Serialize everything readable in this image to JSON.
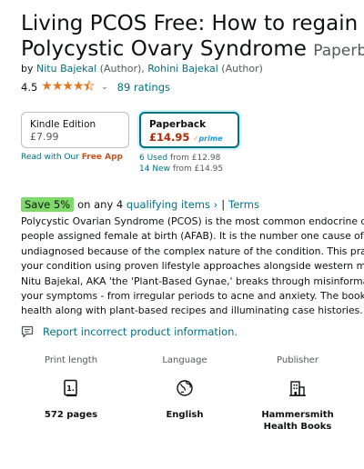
{
  "product": {
    "title": "Living PCOS Free: How to regain your health from",
    "title_line1": "Living PCOS Free: How to regain your",
    "title_line2": "Polycystic Ovary Syndrome",
    "format_label": "Paperback"
  },
  "byline": {
    "by": "by",
    "author1": "Nitu Bajekal",
    "author1_role": "(Author),",
    "author2": "Rohini Bajekal",
    "author2_role": "(Author)"
  },
  "rating": {
    "value": "4.5",
    "stars": "★★★★★",
    "stars_fraction": 0.9,
    "count_text": "89 ratings"
  },
  "formats": [
    {
      "name": "Kindle Edition",
      "price": "£7.99",
      "selected": false
    },
    {
      "name": "Paperback",
      "price": "£14.95",
      "prime": "prime",
      "selected": true
    }
  ],
  "read_app": {
    "prefix": "Read with Our",
    "highlight": "Free App"
  },
  "offers": {
    "used": "6 Used",
    "used_from": "from £12.98",
    "new": "14 New",
    "new_from": "from £14.95"
  },
  "promo": {
    "badge": "Save 5%",
    "text": "on any 4",
    "link": "qualifying items",
    "sep": "|",
    "terms": "Terms"
  },
  "description_lines": [
    "Polycystic Ovarian Syndrome (PCOS) is the most common endocrine disorder in",
    "people assigned female at birth (AFAB). It is the number one cause of infertility",
    "undiagnosed because of the complex nature of the condition. This practical guide",
    "your condition using proven lifestyle approaches alongside western medicine.",
    "Nitu Bajekal, AKA 'the 'Plant-Based Gynae,' breaks through misinformation to",
    "your symptoms - from irregular periods to acne and anxiety. The book features",
    "health along with plant-based recipes and illuminating case histories."
  ],
  "report": {
    "label": "Report incorrect product information."
  },
  "details": [
    {
      "label": "Print length",
      "icon": "book-pages-icon",
      "value": "572 pages"
    },
    {
      "label": "Language",
      "icon": "globe-icon",
      "value": "English"
    },
    {
      "label": "Publisher",
      "icon": "building-icon",
      "value": "Hammersmith\nHealth Books"
    }
  ],
  "colors": {
    "link": "#007185",
    "price": "#B12704",
    "star": "#DE7921",
    "save_badge": "#7FDA69",
    "selected_border": "#007185"
  }
}
